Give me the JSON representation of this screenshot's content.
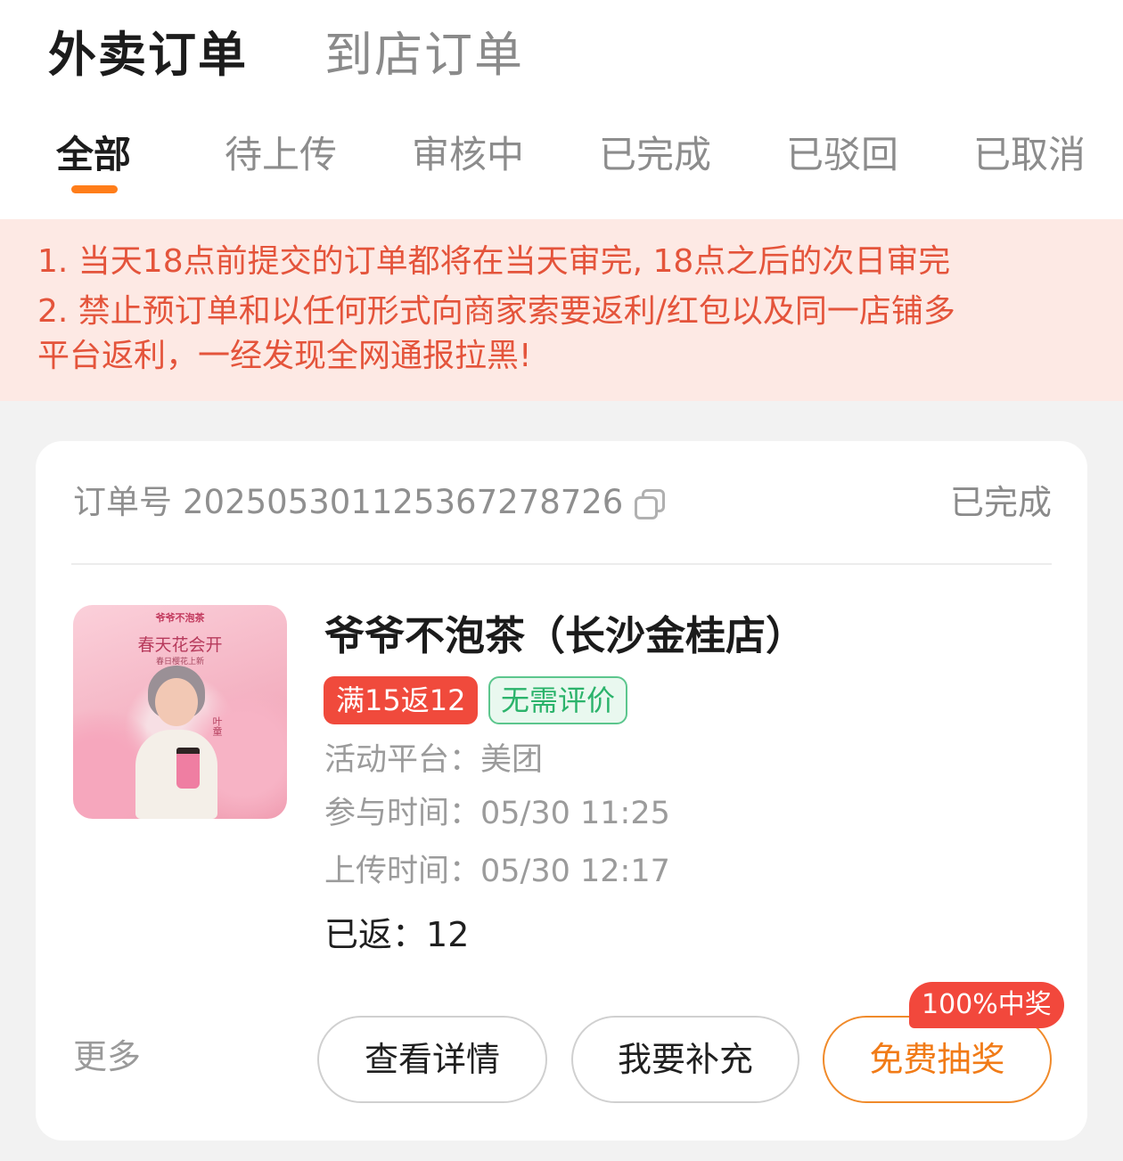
{
  "main_tabs": [
    {
      "label": "外卖订单",
      "active": true
    },
    {
      "label": "到店订单",
      "active": false
    }
  ],
  "sub_tabs": [
    {
      "label": "全部",
      "active": true
    },
    {
      "label": "待上传",
      "active": false
    },
    {
      "label": "审核中",
      "active": false
    },
    {
      "label": "已完成",
      "active": false
    },
    {
      "label": "已驳回",
      "active": false
    },
    {
      "label": "已取消",
      "active": false
    }
  ],
  "notice": {
    "lines": [
      "1. 当天18点前提交的订单都将在当天审完, 18点之后的次日审完",
      "2. 禁止预订单和以任何形式向商家索要返利/红包以及同一店铺多",
      "平台返利，一经发现全网通报拉黑!"
    ]
  },
  "order": {
    "order_no_label": "订单号",
    "order_no": "2025053011253672787​26",
    "status": "已完成",
    "image_text": {
      "brand": "爷爷不泡茶",
      "headline": "春天花会开",
      "sub": "春日樱花上新",
      "sign": "叶童"
    },
    "shop_name": "爷爷不泡茶（长沙金桂店）",
    "tags": [
      "满15返12",
      "无需评价"
    ],
    "platform_label": "活动平台：",
    "platform": "美团",
    "join_time_label": "参与时间：",
    "join_time": "05/30 11:25",
    "upload_time_label": "上传时间：",
    "upload_time": "05/30 12:17",
    "rebate_label": "已返：",
    "rebate": "12",
    "more": "更多",
    "buttons": {
      "detail": "查看详情",
      "supplement": "我要补充",
      "lottery": "免费抽奖"
    },
    "lottery_badge": "100%中奖"
  },
  "colors": {
    "accent_orange": "#ff7d1a",
    "notice_text": "#e4543b",
    "notice_bg": "#fde9e4",
    "tag_red": "#f04a3c",
    "tag_green": "#2bb36b"
  }
}
